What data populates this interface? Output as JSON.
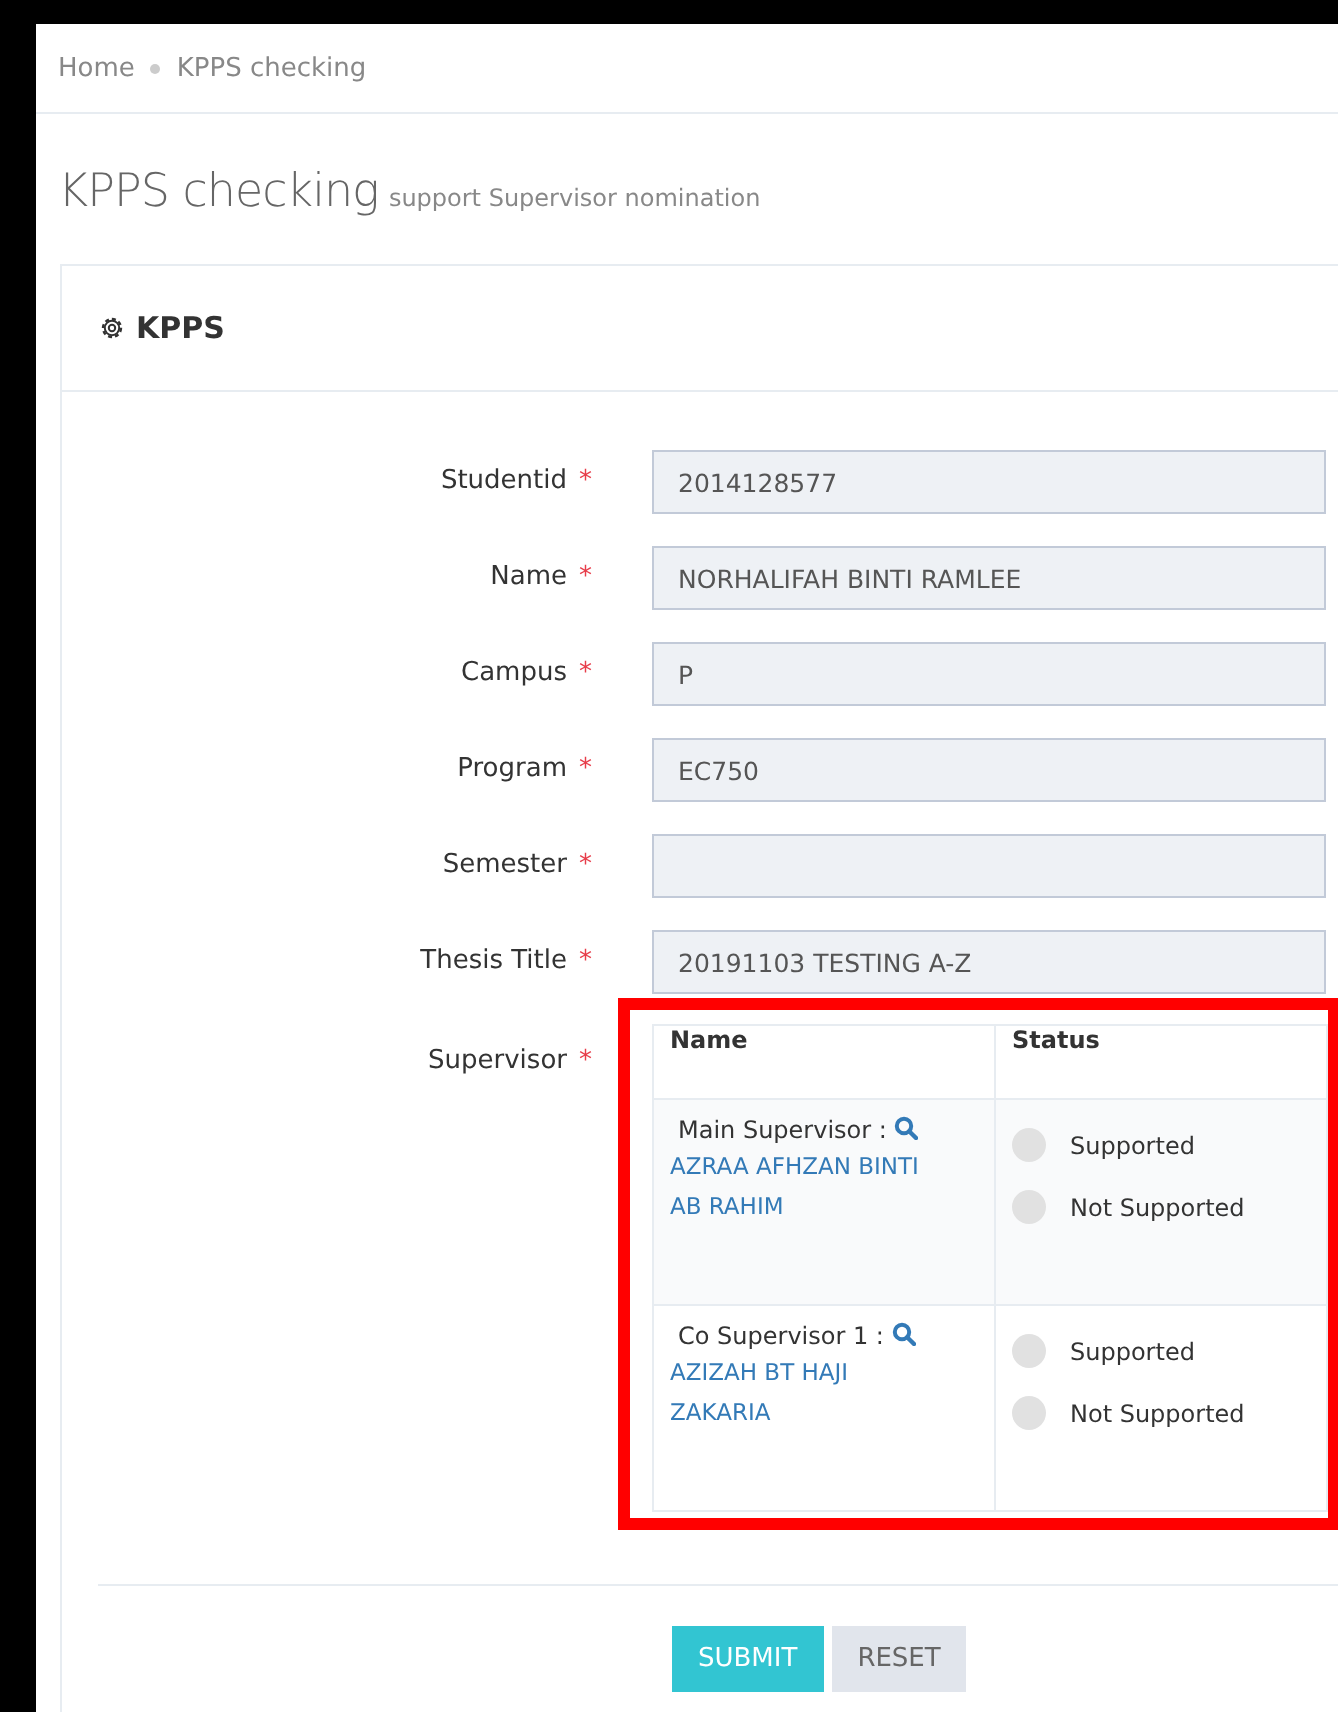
{
  "breadcrumb": [
    "Home",
    "KPPS checking"
  ],
  "page_title": {
    "title": "KPPS checking",
    "subtitle": "support Supervisor nomination"
  },
  "card": {
    "title": "KPPS",
    "fields": [
      {
        "label": "Studentid",
        "required_mark": "*",
        "value": "2014128577"
      },
      {
        "label": "Name",
        "required_mark": "*",
        "value": "NORHALIFAH BINTI RAMLEE"
      },
      {
        "label": "Campus",
        "required_mark": "*",
        "value": "P"
      },
      {
        "label": "Program",
        "required_mark": "*",
        "value": "EC750"
      },
      {
        "label": "Semester",
        "required_mark": "*"
      },
      {
        "label": "Thesis Title",
        "required_mark": "*",
        "value": "20191103 TESTING A-Z"
      }
    ],
    "supervisor": {
      "label": "Supervisor",
      "required_mark": "*",
      "columns": [
        "Name",
        "Status"
      ],
      "rows": [
        {
          "role": "Main Supervisor :",
          "name": "AZRAA AFHZAN BINTI AB RAHIM",
          "options": [
            {
              "label": "Supported",
              "selected": false
            },
            {
              "label": "Not Supported",
              "selected": false
            }
          ]
        },
        {
          "role": "Co Supervisor 1 :",
          "name": "AZIZAH BT HAJI ZAKARIA",
          "options": [
            {
              "label": "Supported",
              "selected": false
            },
            {
              "label": "Not Supported",
              "selected": false
            }
          ]
        }
      ]
    },
    "buttons": [
      {
        "label": "SUBMIT",
        "kind": "primary"
      },
      {
        "label": "RESET",
        "kind": "default"
      }
    ]
  }
}
